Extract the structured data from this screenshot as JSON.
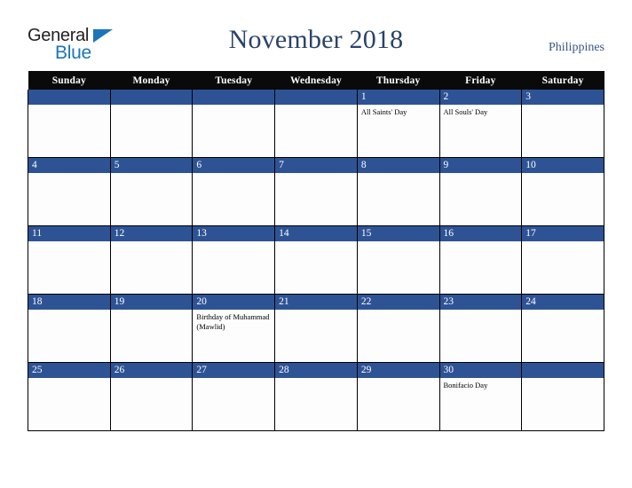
{
  "logo": {
    "word_top": "General",
    "word_bottom": "Blue",
    "triangle_icon": "triangle-icon",
    "brand_blue": "#1b75bb",
    "brand_dark": "#231f20"
  },
  "header": {
    "title": "November 2018",
    "country": "Philippines",
    "title_color": "#2b4269"
  },
  "calendar": {
    "weekday_headers": [
      "Sunday",
      "Monday",
      "Tuesday",
      "Wednesday",
      "Thursday",
      "Friday",
      "Saturday"
    ],
    "header_bg": "#0a0a0a",
    "daynum_bg": "#2e5395",
    "weeks": [
      [
        {
          "day": "",
          "events": []
        },
        {
          "day": "",
          "events": []
        },
        {
          "day": "",
          "events": []
        },
        {
          "day": "",
          "events": []
        },
        {
          "day": "1",
          "events": [
            "All Saints' Day"
          ]
        },
        {
          "day": "2",
          "events": [
            "All Souls' Day"
          ]
        },
        {
          "day": "3",
          "events": []
        }
      ],
      [
        {
          "day": "4",
          "events": []
        },
        {
          "day": "5",
          "events": []
        },
        {
          "day": "6",
          "events": []
        },
        {
          "day": "7",
          "events": []
        },
        {
          "day": "8",
          "events": []
        },
        {
          "day": "9",
          "events": []
        },
        {
          "day": "10",
          "events": []
        }
      ],
      [
        {
          "day": "11",
          "events": []
        },
        {
          "day": "12",
          "events": []
        },
        {
          "day": "13",
          "events": []
        },
        {
          "day": "14",
          "events": []
        },
        {
          "day": "15",
          "events": []
        },
        {
          "day": "16",
          "events": []
        },
        {
          "day": "17",
          "events": []
        }
      ],
      [
        {
          "day": "18",
          "events": []
        },
        {
          "day": "19",
          "events": []
        },
        {
          "day": "20",
          "events": [
            "Birthday of Muhammad (Mawlid)"
          ]
        },
        {
          "day": "21",
          "events": []
        },
        {
          "day": "22",
          "events": []
        },
        {
          "day": "23",
          "events": []
        },
        {
          "day": "24",
          "events": []
        }
      ],
      [
        {
          "day": "25",
          "events": []
        },
        {
          "day": "26",
          "events": []
        },
        {
          "day": "27",
          "events": []
        },
        {
          "day": "28",
          "events": []
        },
        {
          "day": "29",
          "events": []
        },
        {
          "day": "30",
          "events": [
            "Bonifacio Day"
          ]
        },
        {
          "day": "",
          "events": []
        }
      ]
    ]
  }
}
